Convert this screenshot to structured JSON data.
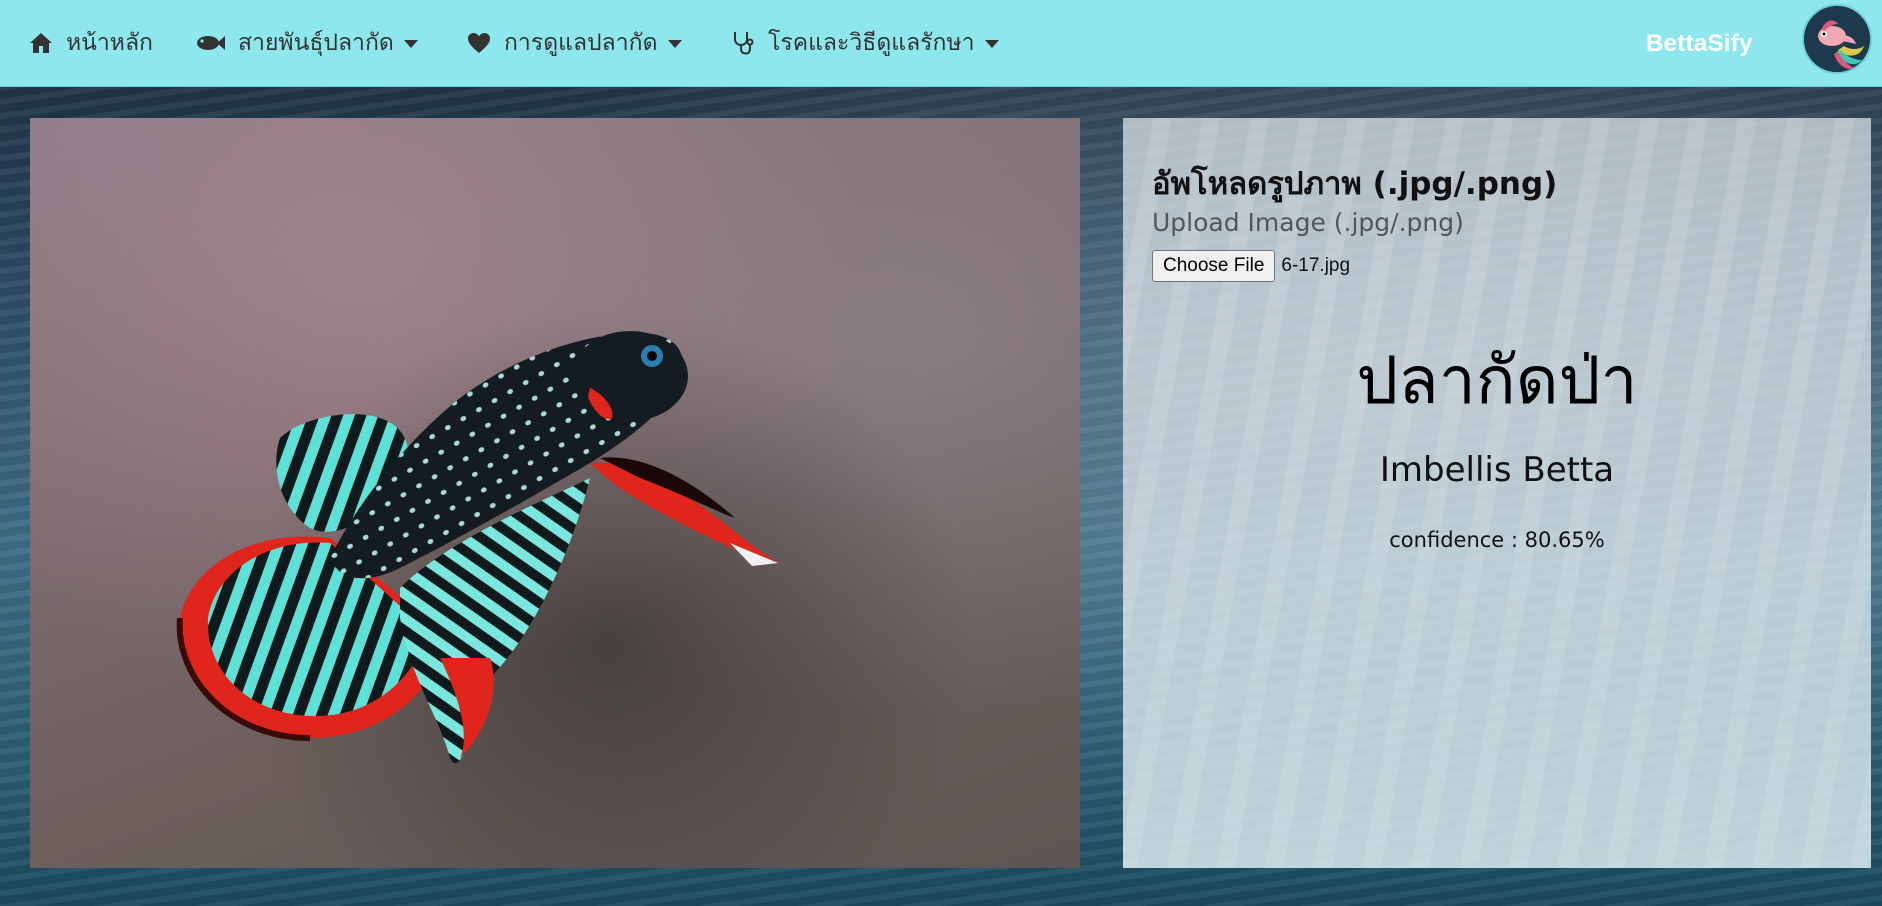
{
  "navbar": {
    "home_label": "หน้าหลัก",
    "breeds_label": "สายพันธุ์ปลากัด",
    "care_label": "การดูแลปลากัด",
    "disease_label": "โรคและวิธีดูแลรักษา",
    "brand": "BettaSify",
    "icons": {
      "home": "home-icon",
      "breeds": "fish-icon",
      "care": "heart-icon",
      "disease": "stethoscope-icon",
      "dropdown": "caret-down-icon"
    }
  },
  "upload": {
    "title": "อัพโหลดรูปภาพ (.jpg/.png)",
    "subtitle": "Upload Image (.jpg/.png)",
    "file_button_label": "Choose File",
    "file_name": "6-17.jpg"
  },
  "result": {
    "thai_name": "ปลากัดป่า",
    "english_name": "Imbellis Betta",
    "confidence_text": "confidence : 80.65%"
  },
  "colors": {
    "navbar_bg": "#8fe7ee",
    "brand_text": "#ffffff",
    "fish_red": "#e0261c",
    "fish_teal": "#4fd8d0"
  }
}
